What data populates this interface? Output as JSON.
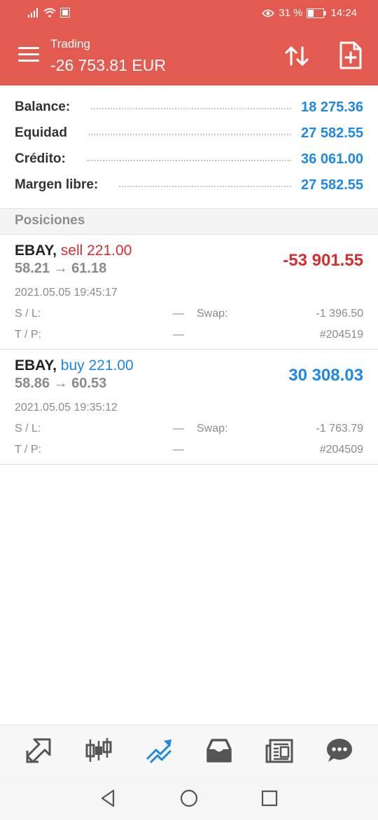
{
  "status_bar": {
    "battery": "31 %",
    "time": "14:24"
  },
  "app_bar": {
    "subtitle": "Trading",
    "title": "-26 753.81 EUR"
  },
  "account": [
    {
      "label": "Balance:",
      "value": "18 275.36"
    },
    {
      "label": "Equidad",
      "value": "27 582.55"
    },
    {
      "label": "Crédito:",
      "value": "36 061.00"
    },
    {
      "label": "Margen libre:",
      "value": "27 582.55"
    }
  ],
  "section_title": "Posiciones",
  "positions": [
    {
      "symbol": "EBAY,",
      "direction_volume": "sell 221.00",
      "prices": "58.21 → 61.18",
      "profit": "-53 901.55",
      "time": "2021.05.05 19:45:17",
      "sl_label": "S / L:",
      "sl_value": "—",
      "tp_label": "T / P:",
      "tp_value": "—",
      "swap_label": "Swap:",
      "swap_value": "-1 396.50",
      "ticket": "#204519"
    },
    {
      "symbol": "EBAY,",
      "direction_volume": "buy 221.00",
      "prices": "58.86 → 60.53",
      "profit": "30 308.03",
      "time": "2021.05.05 19:35:12",
      "sl_label": "S / L:",
      "sl_value": "—",
      "tp_label": "T / P:",
      "tp_value": "—",
      "swap_label": "Swap:",
      "swap_value": "-1 763.79",
      "ticket": "#204509"
    }
  ],
  "colors": {
    "header": "#e35b50",
    "blue": "#1e88e5",
    "red": "#d32f2f",
    "sell": "#d32f2f",
    "buy": "#1e88e5"
  },
  "bottom_nav_icons": [
    "quotes-icon",
    "chart-icon",
    "trade-icon",
    "history-icon",
    "news-icon",
    "chat-icon"
  ]
}
